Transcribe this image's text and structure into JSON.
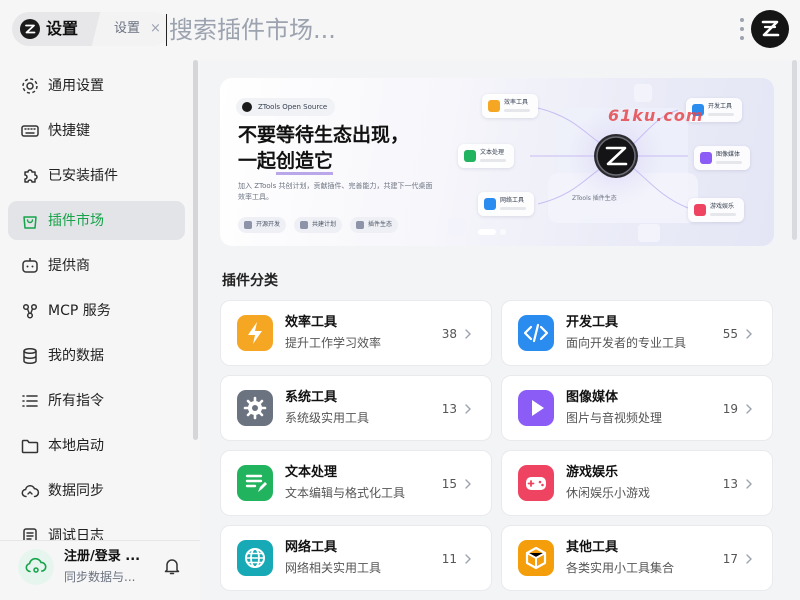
{
  "app": {
    "name": "设置",
    "tab_label": "设置",
    "close_glyph": "×"
  },
  "search": {
    "placeholder": "搜索插件市场..."
  },
  "colors": {
    "accent": "#16a34a",
    "active_bg": "#e3e4e7"
  },
  "sidebar": {
    "items": [
      {
        "label": "通用设置",
        "icon": "gear-icon",
        "active": false
      },
      {
        "label": "快捷键",
        "icon": "keyboard-icon",
        "active": false
      },
      {
        "label": "已安装插件",
        "icon": "puzzle-icon",
        "active": false
      },
      {
        "label": "插件市场",
        "icon": "shopping-bag-icon",
        "active": true
      },
      {
        "label": "提供商",
        "icon": "bot-icon",
        "active": false
      },
      {
        "label": "MCP 服务",
        "icon": "mcp-icon",
        "active": false
      },
      {
        "label": "我的数据",
        "icon": "database-icon",
        "active": false
      },
      {
        "label": "所有指令",
        "icon": "list-icon",
        "active": false
      },
      {
        "label": "本地启动",
        "icon": "folder-icon",
        "active": false
      },
      {
        "label": "数据同步",
        "icon": "cloud-sync-icon",
        "active": false
      },
      {
        "label": "调试日志",
        "icon": "log-icon",
        "active": false
      }
    ],
    "user": {
      "name": "注册/登录 ...",
      "subtitle": "同步数据与..."
    }
  },
  "banner": {
    "badge": "ZTools Open Source",
    "title_line1": "不要等待生态出现，",
    "title_line2_prefix": "一起",
    "title_line2_highlight": "创造它",
    "description": "加入 ZTools 共创计划，贡献插件、完善能力，共建下一代桌面效率工具。",
    "chips": [
      "开源开发",
      "共建计划",
      "插件生态"
    ],
    "core_label": "ZTools 插件生态",
    "watermark": "61ku.com",
    "nodes": [
      "效率工具",
      "文本处理",
      "网络工具",
      "开发工具",
      "图像媒体",
      "游戏娱乐"
    ]
  },
  "categories": {
    "title": "插件分类",
    "items": [
      {
        "title": "效率工具",
        "desc": "提升工作学习效率",
        "count": "38",
        "icon": "lightning-icon",
        "color": "#f5a623"
      },
      {
        "title": "开发工具",
        "desc": "面向开发者的专业工具",
        "count": "55",
        "icon": "code-icon",
        "color": "#2b8cf0"
      },
      {
        "title": "系统工具",
        "desc": "系统级实用工具",
        "count": "13",
        "icon": "gear-icon",
        "color": "#6b7280"
      },
      {
        "title": "图像媒体",
        "desc": "图片与音视频处理",
        "count": "19",
        "icon": "play-icon",
        "color": "#8b5cf6"
      },
      {
        "title": "文本处理",
        "desc": "文本编辑与格式化工具",
        "count": "15",
        "icon": "document-edit-icon",
        "color": "#22b35e"
      },
      {
        "title": "游戏娱乐",
        "desc": "休闲娱乐小游戏",
        "count": "13",
        "icon": "gamepad-icon",
        "color": "#ef4461"
      },
      {
        "title": "网络工具",
        "desc": "网络相关实用工具",
        "count": "11",
        "icon": "globe-icon",
        "color": "#17a9b5"
      },
      {
        "title": "其他工具",
        "desc": "各类实用小工具集合",
        "count": "17",
        "icon": "box-icon",
        "color": "#f59e0b"
      }
    ]
  }
}
